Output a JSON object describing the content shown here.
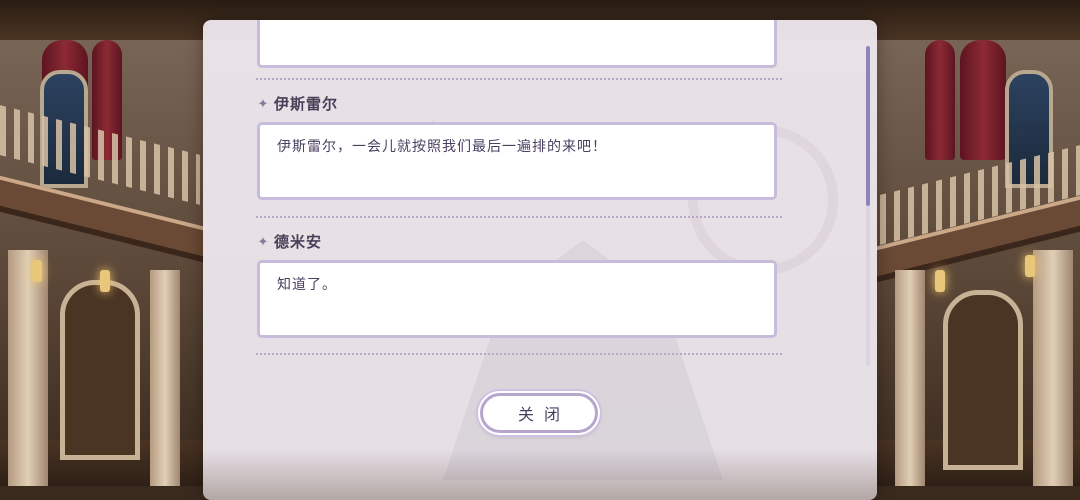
{
  "colors": {
    "panel_bg": "#ece6ec",
    "bubble_border": "#c8bcdc",
    "speaker_text": "#4a4058",
    "dialog_text": "#4a4060",
    "scroll_thumb": "#8e84ba"
  },
  "dialog_log": {
    "entries": [
      {
        "speaker": "",
        "text": ""
      },
      {
        "speaker": "伊斯雷尔",
        "text": "伊斯雷尔，一会儿就按照我们最后一遍排的来吧！"
      },
      {
        "speaker": "德米安",
        "text": "知道了。"
      }
    ],
    "speaker_icon": "sparkle-icon",
    "scroll_position": 0.0
  },
  "close_button": {
    "label": "关闭"
  }
}
